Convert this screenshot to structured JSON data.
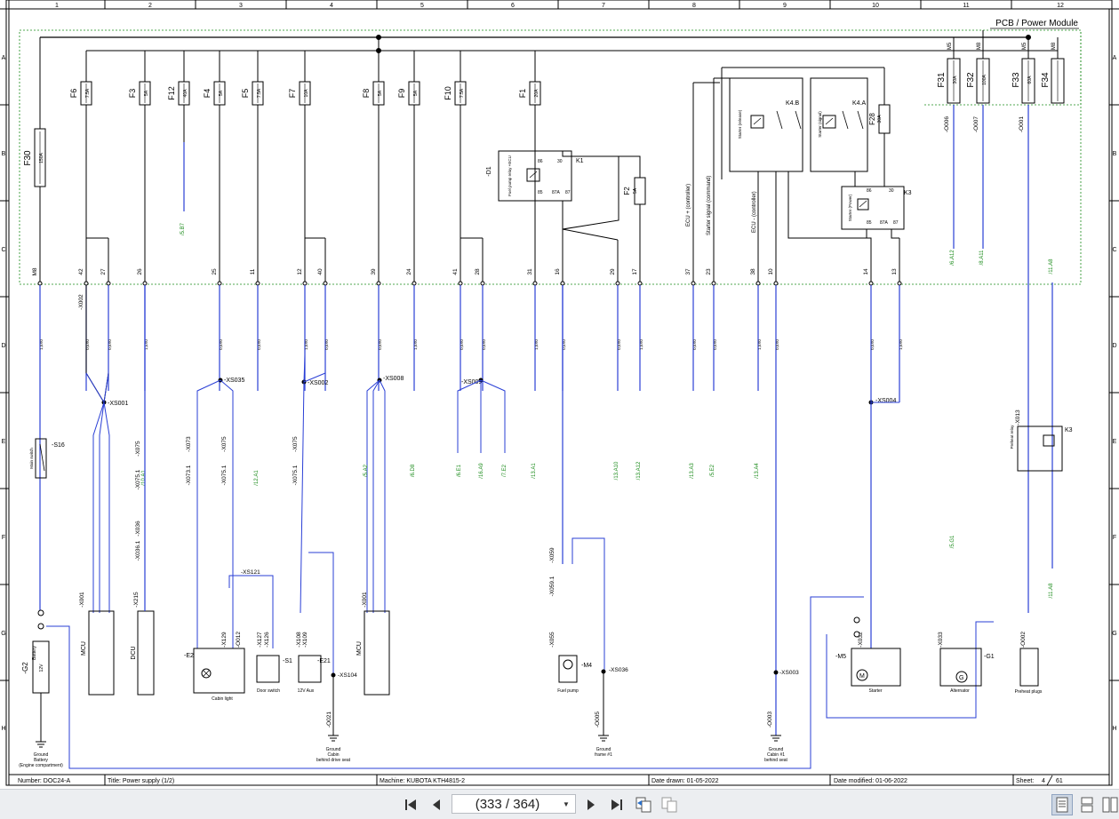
{
  "viewer": {
    "page_indicator": "(333 / 364)"
  },
  "sheet": {
    "title_box": "PCB / Power Module",
    "columns": [
      "1",
      "2",
      "3",
      "4",
      "5",
      "6",
      "7",
      "8",
      "9",
      "10",
      "11",
      "12"
    ],
    "rows": [
      "A",
      "B",
      "C",
      "D",
      "E",
      "F",
      "G",
      "H"
    ],
    "footer": {
      "number": "Number: DOC24-A",
      "title": "Title: Power supply (1/2)",
      "machine": "Machine: KUBOTA KTH4815-2",
      "date_drawn": "Date drawn: 01-05-2022",
      "date_modified": "Date modified: 01-06-2022",
      "sheet_label": "Sheet:",
      "sheet_page": "4",
      "sheet_total": "61"
    }
  },
  "diagram": {
    "fuses": [
      {
        "name": "F6",
        "rating": "7.5A"
      },
      {
        "name": "F3",
        "rating": "5A"
      },
      {
        "name": "F12",
        "rating": "40A"
      },
      {
        "name": "F4",
        "rating": "5A"
      },
      {
        "name": "F5",
        "rating": "7.5A"
      },
      {
        "name": "F7",
        "rating": "10A"
      },
      {
        "name": "F8",
        "rating": "5A"
      },
      {
        "name": "F9",
        "rating": "5A"
      },
      {
        "name": "F10",
        "rating": "7.5A"
      },
      {
        "name": "F1",
        "rating": "20A"
      },
      {
        "name": "F30",
        "rating": "150A"
      },
      {
        "name": "F2",
        "rating": "5A"
      },
      {
        "name": "F28",
        "rating": "30A"
      },
      {
        "name": "F31",
        "rating": "30A"
      },
      {
        "name": "F32",
        "rating": "100A"
      },
      {
        "name": "F33",
        "rating": "60A"
      },
      {
        "name": "F34",
        "rating": ""
      }
    ],
    "top_labels": [
      "M5",
      "M8",
      "M5",
      "M8"
    ],
    "relays": [
      {
        "name": "K1",
        "label": "Fuel pump relay +ECU"
      },
      {
        "name": "K4.B",
        "label": "Starter (release)"
      },
      {
        "name": "K4.A",
        "label": "Starter (signal)"
      },
      {
        "name": "K3",
        "label": "Starter (Power)"
      },
      {
        "name": "K3",
        "label": "Preheat relay"
      }
    ],
    "diode": "-D1",
    "pins": [
      "M8",
      "42",
      "27",
      "26",
      "25",
      "11",
      "12",
      "40",
      "39",
      "24",
      "41",
      "28",
      "31",
      "16",
      "29",
      "17",
      "37",
      "23",
      "38",
      "10",
      "14",
      "13"
    ],
    "connectors": [
      "-X002",
      "-XS001",
      "-XS035",
      "-XS002",
      "-XS008",
      "-XS009",
      "-XS004",
      "-X013",
      "-X075",
      "-X073",
      "-X075.1",
      "-X036",
      "-X036.1",
      "-X215",
      "-X001",
      "-X128",
      "-X129",
      "-X127",
      "-X126",
      "-X108",
      "-X109",
      "-X059",
      "-X059.1",
      "-X055",
      "-X032",
      "-X033",
      "-X002",
      "-X006",
      "-X007",
      "-X001",
      "-XS121",
      "-XS104",
      "-XS036",
      "-XS003",
      "-O012",
      "-O021",
      "-O005",
      "-O003",
      "-O006",
      "-O007",
      "-O001",
      "-O002"
    ],
    "vertical_labels": [
      "ECU + (controller)",
      "Starter signal (command)",
      "ECU - (controller)"
    ],
    "refs": [
      "/5.B7",
      "/6.A12",
      "/8.A11",
      "/11.A8",
      "/11.A8",
      "/12.A1",
      "/10.A1",
      "/5.A2",
      "/6.D8",
      "/6.E1",
      "/16.A9",
      "/7.E2",
      "/13.A1",
      "/13.A10",
      "/13.A12",
      "/13.A3",
      "/5.E2",
      "/13.A4",
      "/5.G1"
    ],
    "components": [
      {
        "id": "-G2",
        "label": "Battery",
        "value": "12V"
      },
      {
        "id": "-S16",
        "label": "Main switch"
      },
      {
        "id": "-E2",
        "label": "Cabin light"
      },
      {
        "id": "-S1",
        "label": "Door switch"
      },
      {
        "id": "-E21",
        "label": "12V Aux"
      },
      {
        "id": "-M4",
        "label": "Fuel pump"
      },
      {
        "id": "-M5",
        "label": "Starter"
      },
      {
        "id": "-G1",
        "label": "Alternator"
      },
      {
        "id": "",
        "label": "Preheat plugs"
      },
      {
        "id": "MCU",
        "label": "MCU"
      },
      {
        "id": "DCU",
        "label": "DCU"
      }
    ],
    "grounds": [
      {
        "label": "Ground\nBattery\n(Engine compartment)"
      },
      {
        "label": "Ground\nCabin\nbehind drive seat"
      },
      {
        "label": "Ground\nframe #1"
      },
      {
        "label": "Ground\nCabin #1\nbehind seat"
      }
    ],
    "wire_sizes": [
      "35X0",
      "1,5X0",
      "1,5X0",
      "0,5X0",
      "1,5X0",
      "1,5X0",
      "6X0",
      "1,5BR",
      "1,5BR",
      "0,5X0",
      "0,5X0",
      "6X0",
      "16",
      "16"
    ]
  }
}
